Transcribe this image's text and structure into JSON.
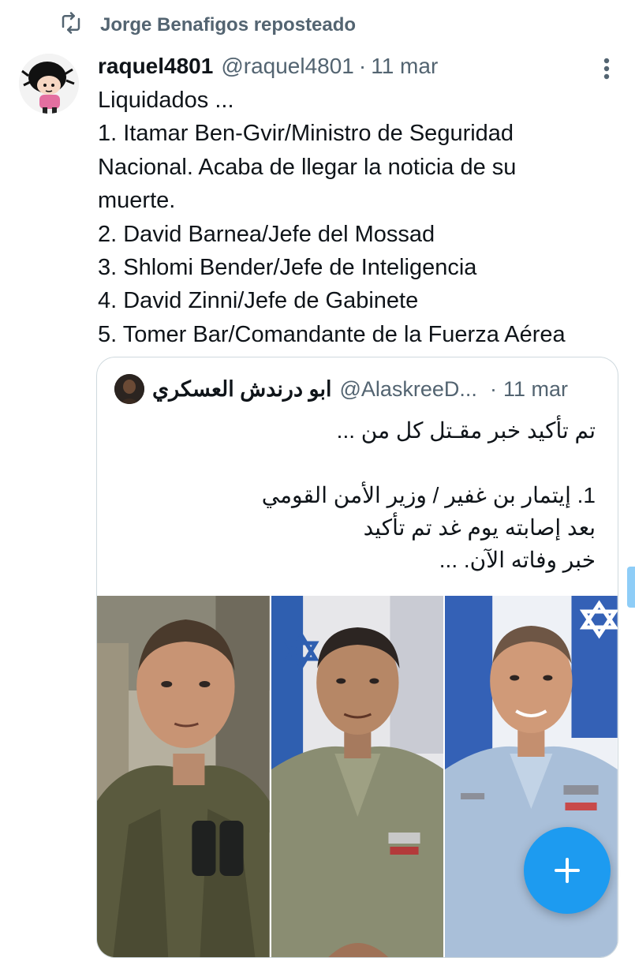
{
  "repost": {
    "text": "Jorge Benafigos reposteado",
    "icon": "repost-icon"
  },
  "tweet": {
    "author_name": "raquel4801",
    "author_handle": "@raquel4801",
    "separator": "·",
    "date": "11 mar",
    "lines": [
      "Liquidados ...",
      "1. Itamar Ben-Gvir/Ministro de Seguridad",
      "Nacional. Acaba de llegar la noticia de su",
      "muerte.",
      "2. David Barnea/Jefe del Mossad",
      "3. Shlomi Bender/Jefe de Inteligencia",
      "4. David Zinni/Jefe de Gabinete",
      "5. Tomer Bar/Comandante de la Fuerza Aérea"
    ]
  },
  "quote": {
    "author_name": "ابو درندش العسكري",
    "author_handle": "@AlaskreeD...",
    "separator": "·",
    "date": "11 mar",
    "lines": [
      "تم تأكيد خبر مقـتل كل من ...",
      "",
      "1. إيتمار بن غفير  /  وزير الأمن القومي",
      "بعد إصابته يوم غد تم تأكيد",
      "خبر وفاته الآن. ..."
    ]
  },
  "fab": {
    "icon": "plus-icon",
    "label": "+"
  },
  "colors": {
    "accent": "#1d9bf0",
    "muted": "#536471",
    "border": "#cfd9de"
  }
}
